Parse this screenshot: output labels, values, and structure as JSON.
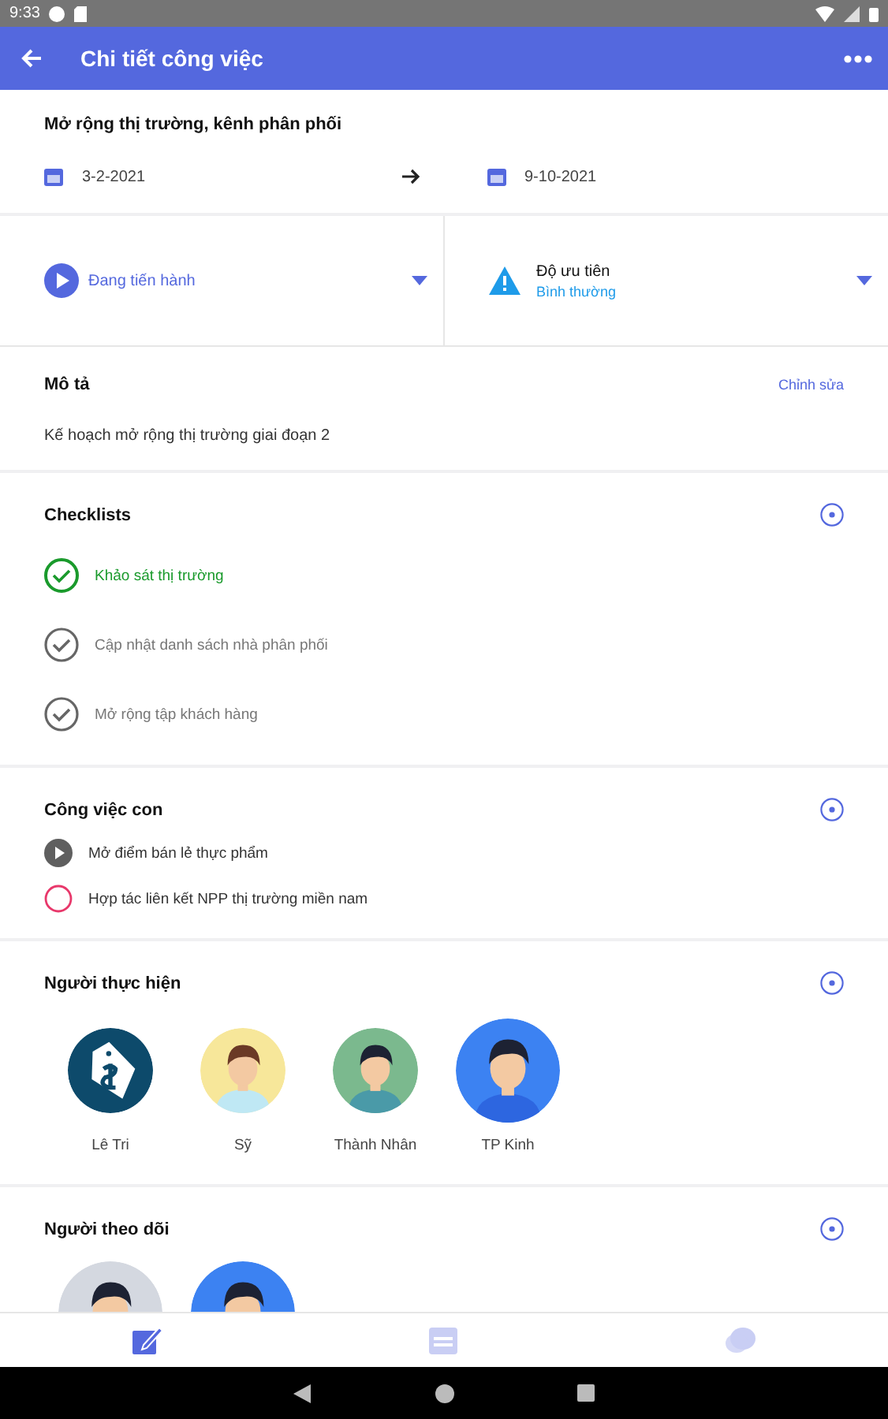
{
  "status_bar": {
    "time": "9:33"
  },
  "app_bar": {
    "title": "Chi tiết công việc"
  },
  "task": {
    "name": "Mở rộng thị trường, kênh phân phối",
    "start_date": "3-2-2021",
    "end_date": "9-10-2021"
  },
  "status": {
    "label": "Đang tiến hành"
  },
  "priority": {
    "label": "Độ ưu tiên",
    "value": "Bình thường"
  },
  "description": {
    "heading": "Mô tả",
    "edit": "Chỉnh sửa",
    "text": "Kế hoạch mở rộng thị trường giai đoạn 2"
  },
  "checklists": {
    "heading": "Checklists",
    "items": [
      {
        "label": "Khảo sát thị trường",
        "checked": true
      },
      {
        "label": "Cập nhật danh sách nhà phân phối",
        "checked": false
      },
      {
        "label": "Mở rộng tập khách hàng",
        "checked": false
      }
    ]
  },
  "subtasks": {
    "heading": "Công việc con",
    "items": [
      {
        "label": "Mở điểm bán lẻ thực phẩm",
        "kind": "in_progress"
      },
      {
        "label": "Hợp tác liên kết NPP thị trường miền nam",
        "kind": "not_started"
      }
    ]
  },
  "assignees": {
    "heading": "Người thực hiện",
    "people": [
      {
        "name": "Lê Tri",
        "kind": "tag"
      },
      {
        "name": "Sỹ",
        "kind": "yellow"
      },
      {
        "name": "Thành Nhân",
        "kind": "green"
      },
      {
        "name": "TP Kinh",
        "kind": "blue"
      }
    ]
  },
  "followers": {
    "heading": "Người theo dõi",
    "people": [
      {
        "kind": "grey"
      },
      {
        "kind": "blue"
      }
    ]
  },
  "bottom_nav": [
    {
      "kind": "edit",
      "selected": true
    },
    {
      "kind": "calendar",
      "selected": false
    },
    {
      "kind": "chat",
      "selected": false
    }
  ]
}
